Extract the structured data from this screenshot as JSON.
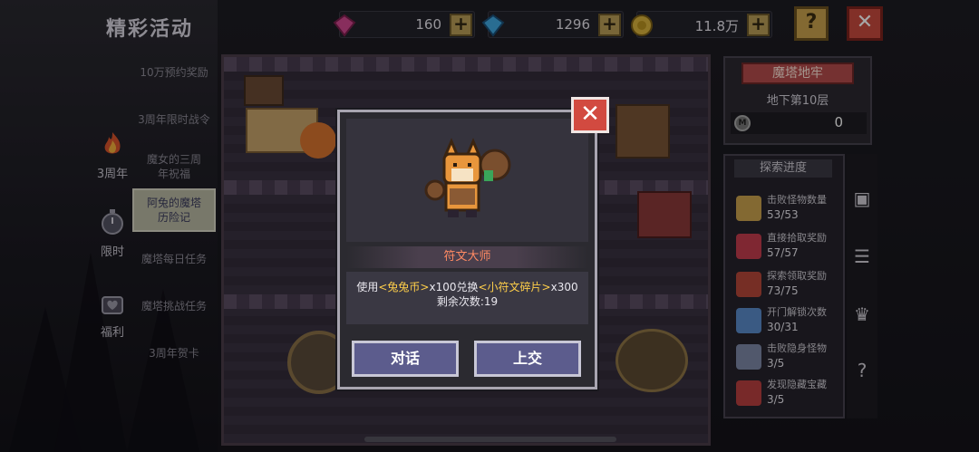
{
  "header": {
    "title": "精彩活动",
    "resources": [
      {
        "name": "pink-gem",
        "value": "160",
        "color": "#d2488f"
      },
      {
        "name": "blue-gem",
        "value": "1296",
        "color": "#3fa8e0"
      },
      {
        "name": "gold-coin",
        "value": "11.8万",
        "color": "#d9b23c"
      }
    ],
    "plus_label": "+",
    "help_label": "?",
    "close_label": "✕"
  },
  "sidebar": {
    "icon_tabs": [
      {
        "label": "3周年",
        "icon": "flame-icon"
      },
      {
        "label": "限时",
        "icon": "stopwatch-icon"
      },
      {
        "label": "福利",
        "icon": "gift-heart-icon"
      }
    ],
    "menu": [
      {
        "label": "10万预约奖励",
        "active": false
      },
      {
        "label": "3周年限时战令",
        "active": false
      },
      {
        "label": "魔女的三周年祝福",
        "active": false
      },
      {
        "label": "阿兔的魔塔历险记",
        "active": true
      },
      {
        "label": "魔塔每日任务",
        "active": false
      },
      {
        "label": "魔塔挑战任务",
        "active": false
      },
      {
        "label": "3周年贺卡",
        "active": false
      }
    ]
  },
  "right_panel": {
    "title": "魔塔地牢",
    "floor": "地下第10层",
    "currency_icon_label": "M",
    "currency_value": "0",
    "progress_title": "探索进度",
    "progress_items": [
      {
        "label": "击败怪物数量",
        "value": "53/53",
        "icon": "sword-icon",
        "color": "#c9a24d"
      },
      {
        "label": "直接拾取奖励",
        "value": "57/57",
        "icon": "ruby-icon",
        "color": "#c33d4d"
      },
      {
        "label": "探索领取奖励",
        "value": "73/75",
        "icon": "chest-icon",
        "color": "#b5473a"
      },
      {
        "label": "开门解锁次数",
        "value": "30/31",
        "icon": "gate-icon",
        "color": "#5a8ac9"
      },
      {
        "label": "击败隐身怪物",
        "value": "3/5",
        "icon": "ghost-icon",
        "color": "#7d87a6"
      },
      {
        "label": "发现隐藏宝藏",
        "value": "3/5",
        "icon": "treasure-icon",
        "color": "#b84040"
      }
    ],
    "side_icons": [
      "shop-icon",
      "scroll-icon",
      "trophy-icon",
      "question-icon"
    ]
  },
  "dialog": {
    "npc_name": "符文大师",
    "text_prefix": "使用",
    "item_cost": "<兔兔币>",
    "cost_qty": "x100兑换",
    "item_reward": "<小符文碎片>",
    "reward_qty": "x300",
    "remaining": "剩余次数:19",
    "buttons": {
      "talk": "对话",
      "submit": "上交"
    },
    "close_label": "✕"
  }
}
